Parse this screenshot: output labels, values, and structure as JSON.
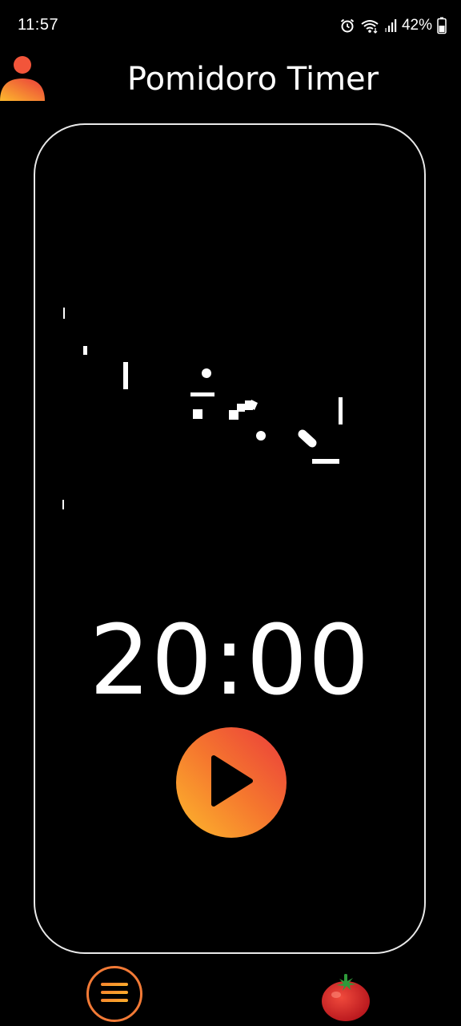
{
  "status_bar": {
    "time": "11:57",
    "battery": "42%",
    "icons": [
      "alarm-icon",
      "wifi-icon",
      "signal-icon",
      "battery-icon"
    ]
  },
  "header": {
    "title": "Pomidoro Timer",
    "avatar_icon": "user-avatar-icon"
  },
  "timer": {
    "time": "20:00",
    "play_icon": "play-icon"
  },
  "bottom_nav": {
    "menu_icon": "menu-icon",
    "tomato_icon": "tomato-icon"
  },
  "colors": {
    "background": "#000000",
    "accent_orange": "#f5772e",
    "accent_red": "#ea3b3c",
    "accent_yellow": "#fdb92c",
    "text": "#ffffff"
  }
}
